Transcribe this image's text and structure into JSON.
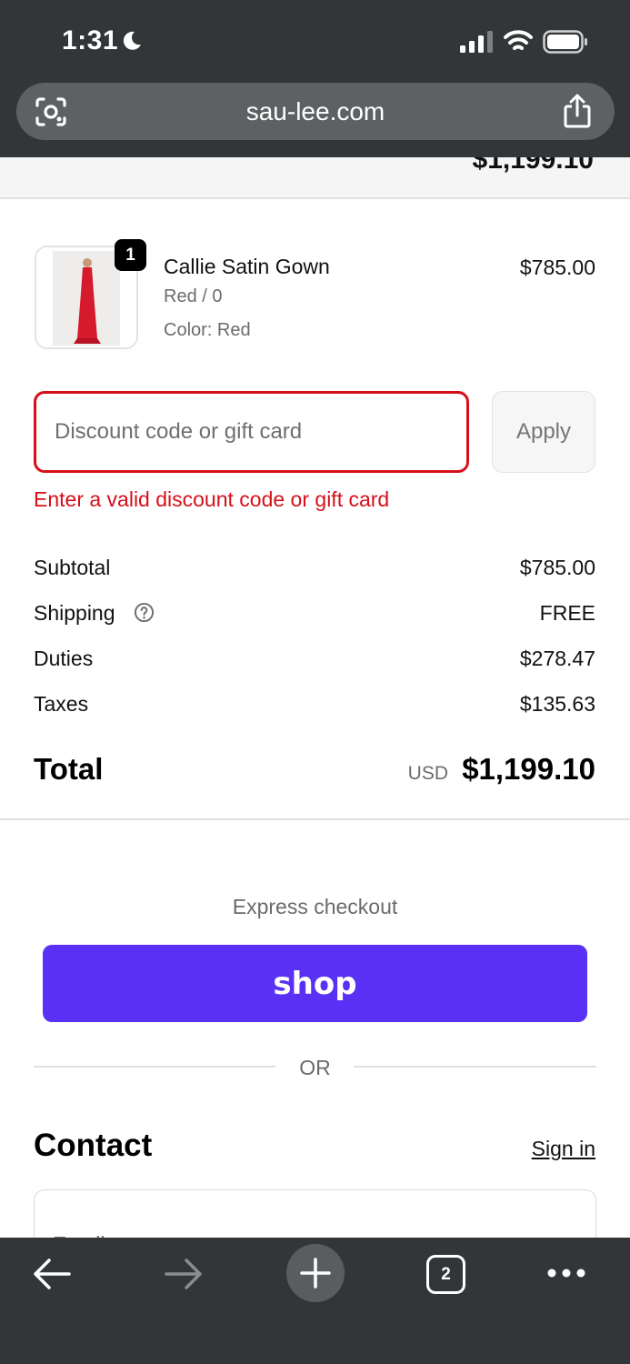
{
  "status_bar": {
    "time": "1:31"
  },
  "browser": {
    "url": "sau-lee.com",
    "tab_count": "2"
  },
  "scrolled_fragment": "$1,199.10",
  "line_item": {
    "quantity": "1",
    "name": "Callie Satin Gown",
    "variant": "Red / 0",
    "color": "Color: Red",
    "price": "$785.00"
  },
  "discount": {
    "placeholder": "Discount code or gift card",
    "apply_label": "Apply",
    "error": "Enter a valid discount code or gift card"
  },
  "summary": {
    "subtotal_label": "Subtotal",
    "subtotal_value": "$785.00",
    "shipping_label": "Shipping",
    "shipping_value": "FREE",
    "duties_label": "Duties",
    "duties_value": "$278.47",
    "taxes_label": "Taxes",
    "taxes_value": "$135.63",
    "total_label": "Total",
    "currency": "USD",
    "total_value": "$1,199.10"
  },
  "express": {
    "label": "Express checkout",
    "shop_label": "shop",
    "or_label": "OR"
  },
  "contact": {
    "title": "Contact",
    "signin_label": "Sign in",
    "email_placeholder": "Email"
  },
  "colors": {
    "error_red": "#d6101a",
    "shop_purple": "#5a31f4",
    "chrome_dark": "#333638",
    "product_red": "#d41a2c"
  },
  "icons": [
    "moon-icon",
    "cellular-signal-icon",
    "wifi-icon",
    "battery-icon",
    "camera-lens-icon",
    "share-icon",
    "help-circle-icon",
    "back-arrow-icon",
    "forward-arrow-icon",
    "plus-icon",
    "more-dots-icon"
  ]
}
